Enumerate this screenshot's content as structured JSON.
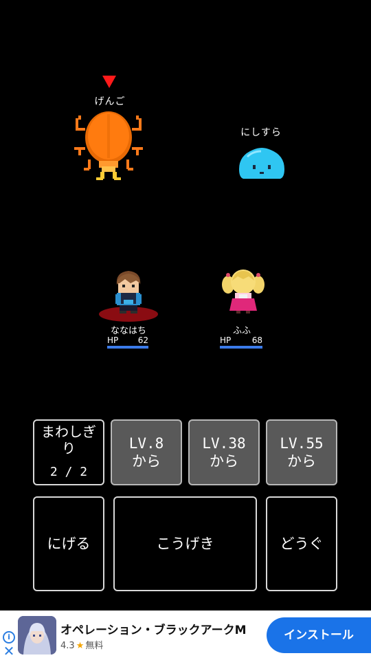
{
  "enemies": [
    {
      "name": "げんご",
      "targeted": true
    },
    {
      "name": "にしすら",
      "targeted": false
    }
  ],
  "party": [
    {
      "name": "ななはち",
      "hp_label": "HP",
      "hp": "62",
      "hp_fraction": 1.0
    },
    {
      "name": "ふふ",
      "hp_label": "HP",
      "hp": "68",
      "hp_fraction": 1.0
    }
  ],
  "skills": [
    {
      "line1": "まわしぎ",
      "line2": "り",
      "uses": "2 / 2"
    },
    {
      "line1": "LV.8",
      "line2": "から"
    },
    {
      "line1": "LV.38",
      "line2": "から"
    },
    {
      "line1": "LV.55",
      "line2": "から"
    }
  ],
  "actions": {
    "run": "にげる",
    "attack": "こうげき",
    "item": "どうぐ"
  },
  "ad": {
    "title": "オペレーション・ブラックアークM",
    "rating": "4.3",
    "price": "無料",
    "install_label": "インストール"
  },
  "colors": {
    "target_arrow": "#ff1a1a",
    "hp_bar": "#3b7bea",
    "install_button": "#1a73e8"
  }
}
